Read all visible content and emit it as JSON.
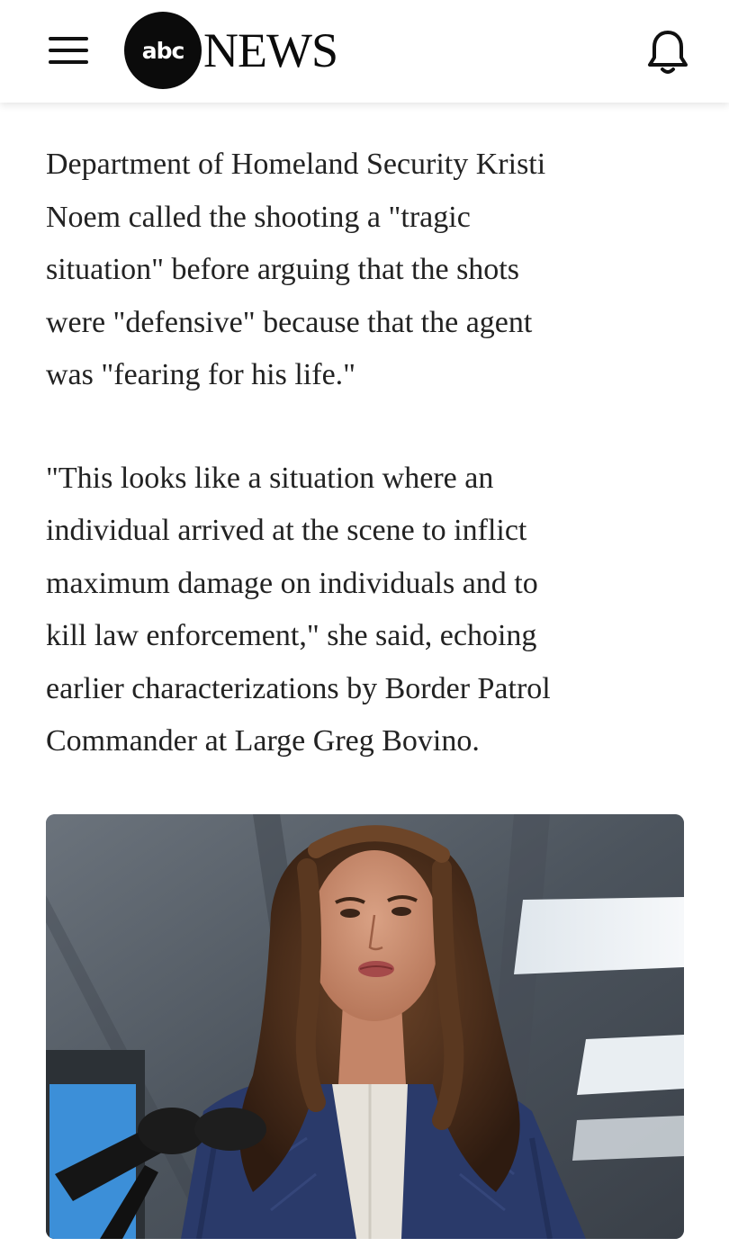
{
  "header": {
    "menu_icon": "hamburger-menu-icon",
    "logo_disc_text": "abc",
    "logo_word": "NEWS",
    "notification_icon": "bell-icon"
  },
  "article": {
    "paragraphs": [
      "Department of Homeland Security Kristi\nNoem called the shooting a \"tragic\nsituation\" before arguing that the shots\nwere \"defensive\" because that the agent\nwas \"fearing for his life.\"",
      "\"This looks like a situation where an\nindividual arrived at the scene to inflict\nmaximum damage on individuals and to\nkill law enforcement,\" she said, echoing\nearlier characterizations by Border Patrol\nCommander at Large Greg Bovino."
    ],
    "photo": {
      "subject": "woman with long brown wavy hair in navy quilted jacket speaking at a microphone"
    }
  },
  "colors": {
    "text": "#222222",
    "brand_black": "#0b0b0b",
    "background": "#ffffff",
    "jacket_navy": "#2a3a6a"
  }
}
